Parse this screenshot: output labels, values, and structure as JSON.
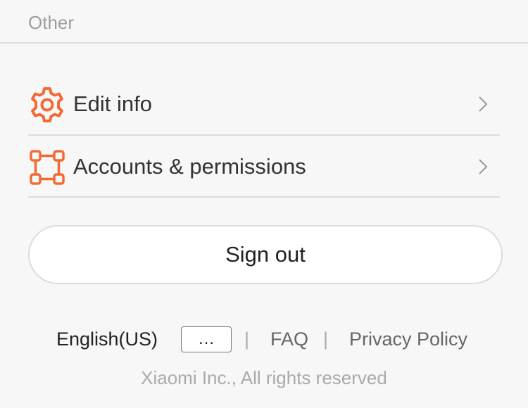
{
  "section": {
    "title": "Other"
  },
  "menu": {
    "items": [
      {
        "label": "Edit info",
        "icon": "gear-icon"
      },
      {
        "label": "Accounts & permissions",
        "icon": "nodes-icon"
      }
    ]
  },
  "signout": {
    "label": "Sign out"
  },
  "footer": {
    "language": "English(US)",
    "more_label": "…",
    "separator": "|",
    "faq": "FAQ",
    "privacy": "Privacy Policy",
    "copyright": "Xiaomi Inc., All rights reserved"
  },
  "colors": {
    "accent": "#f26b35",
    "background": "#f7f7f7",
    "divider": "#dcdcdc"
  }
}
